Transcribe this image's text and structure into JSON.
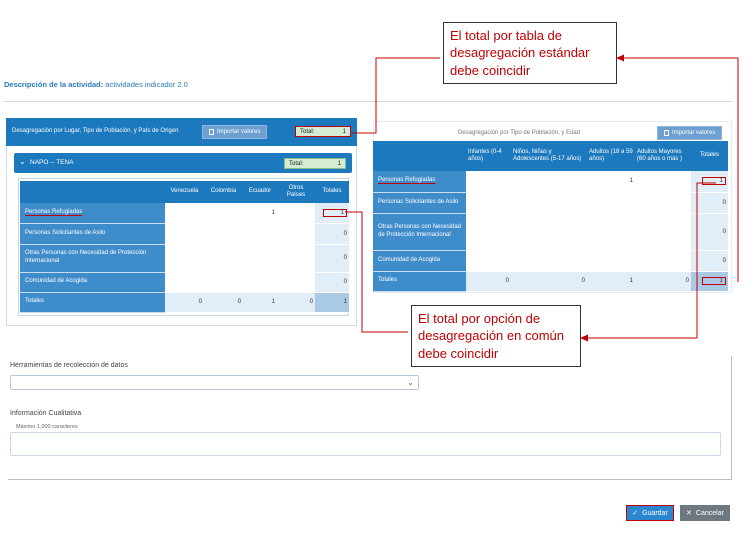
{
  "activity": {
    "label": "Descripción de la actividad:",
    "value": "actividades indicador 2.0"
  },
  "left": {
    "title": "Desagregación por Lugar, Tipo de Población, y País de Origen",
    "import_label": "Importar valores",
    "total_label": "Total:",
    "total_value": "1",
    "location": "NAPO -- TENA",
    "location_total_label": "Total:",
    "location_total_value": "1",
    "columns": [
      "Venezuela",
      "Colombia",
      "Ecuador",
      "Otros Países",
      "Totales"
    ],
    "rows": [
      {
        "label": "Personas Refugiadas",
        "cells": [
          "",
          "",
          "1",
          "",
          "1"
        ]
      },
      {
        "label": "Personas Solicitantes de Asilo",
        "cells": [
          "",
          "",
          "",
          "",
          "0"
        ]
      },
      {
        "label": "Otras Personas con Necesidad de Protección Internacional",
        "cells": [
          "",
          "",
          "",
          "",
          "0"
        ]
      },
      {
        "label": "Comunidad de Acogida",
        "cells": [
          "",
          "",
          "",
          "",
          "0"
        ]
      }
    ],
    "totals": {
      "label": "Totales",
      "cells": [
        "0",
        "0",
        "1",
        "0",
        "1"
      ]
    }
  },
  "right": {
    "title": "Desagregación por Tipo de Población, y Edad",
    "import_label": "Importar valores",
    "columns": [
      "Infantes (0-4 años)",
      "Niños, Niñas y Adolescentes (5-17 años)",
      "Adultos (18 a 59 años)",
      "Adultos Mayores (60 años o más )",
      "Totales"
    ],
    "rows": [
      {
        "label": "Personas Refugiadas",
        "cells": [
          "",
          "",
          "1",
          "",
          "1"
        ]
      },
      {
        "label": "Personas Solicitantes de Asilo",
        "cells": [
          "",
          "",
          "",
          "",
          "0"
        ]
      },
      {
        "label": "Otras Personas con Necesidad de Protección Internacional",
        "cells": [
          "",
          "",
          "",
          "",
          "0"
        ]
      },
      {
        "label": "Comunidad de Acogida",
        "cells": [
          "",
          "",
          "",
          "",
          "0"
        ]
      }
    ],
    "totals": {
      "label": "Totales",
      "cells": [
        "0",
        "0",
        "1",
        "0",
        "1"
      ]
    }
  },
  "callouts": {
    "table_total": "El total por tabla de desagregación estándar debe coincidir",
    "option_total": "El total por opción de desagregación en común debe coincidir"
  },
  "form": {
    "tools_label": "Herramientas de recolección de datos",
    "tools_value": "",
    "qual_label": "Información Cualitativa",
    "qual_hint": "Máximo 1,000 caracteres",
    "qual_value": ""
  },
  "buttons": {
    "save": "Guardar",
    "cancel": "Cancelar"
  },
  "colors": {
    "primary": "#1d79be",
    "row_label": "#3f8ccb",
    "total_box": "#d3ecd2",
    "callout_red": "#c00000"
  }
}
